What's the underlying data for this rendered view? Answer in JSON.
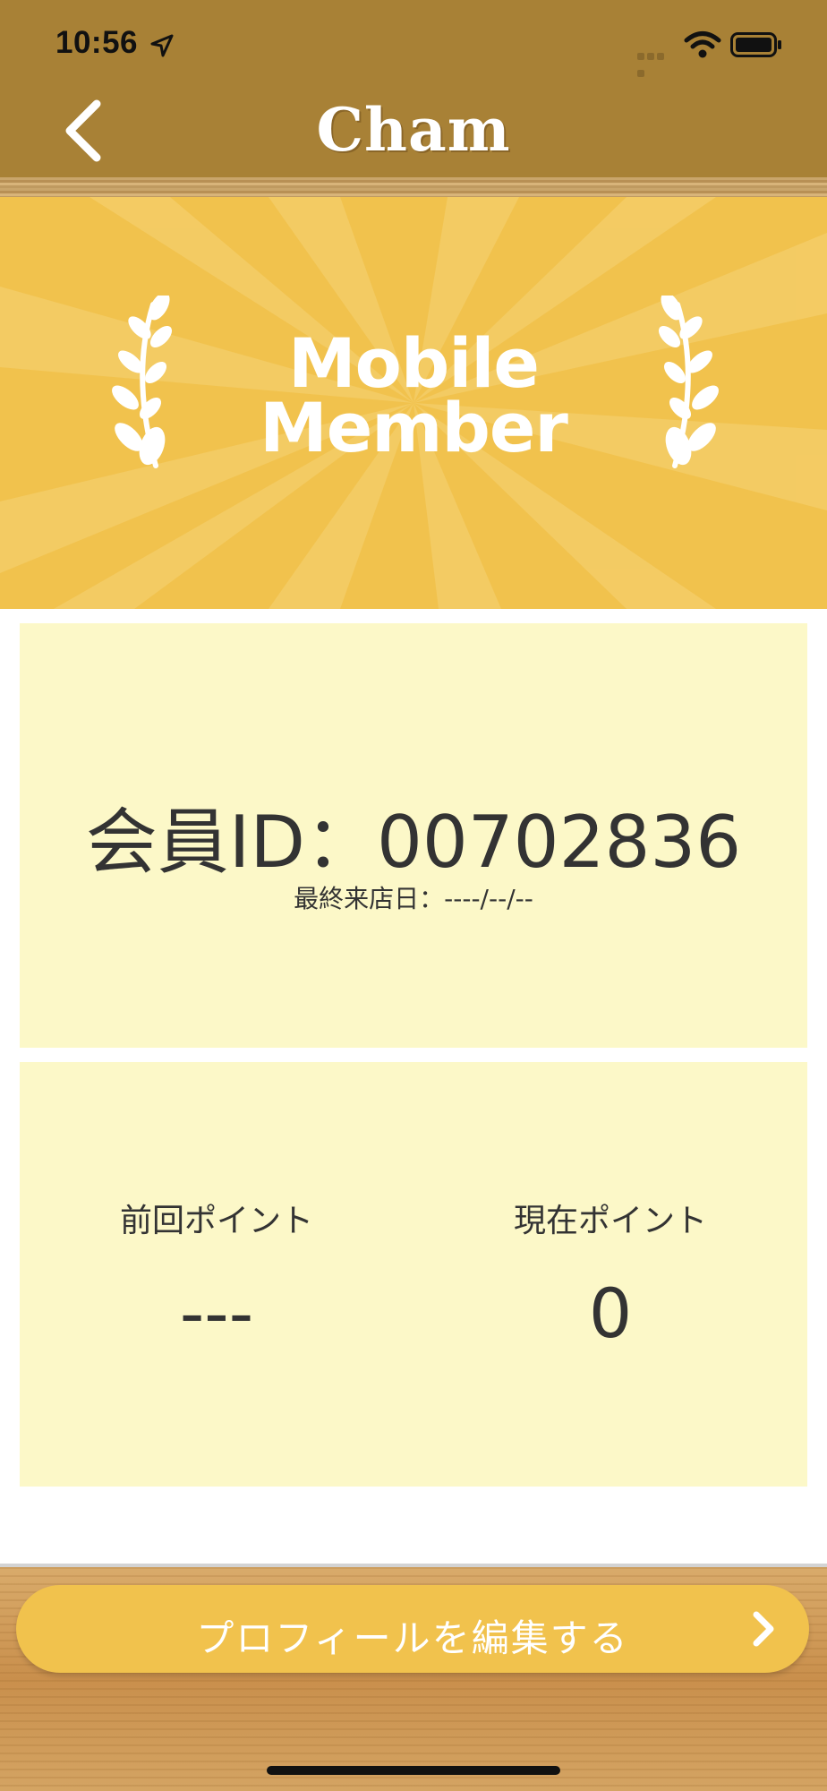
{
  "status_bar": {
    "time": "10:56"
  },
  "nav": {
    "brand": "Cham"
  },
  "hero": {
    "title_line1": "Mobile",
    "title_line2": "Member"
  },
  "member": {
    "id_text": "会員ID：00702836",
    "last_visit": "最終来店日：----/--/--"
  },
  "points": {
    "previous_label": "前回ポイント",
    "previous_value": "---",
    "current_label": "現在ポイント",
    "current_value": "0"
  },
  "actions": {
    "edit_profile_label": "プロフィールを編集する"
  },
  "colors": {
    "nav_bg": "#a88136",
    "accent_yellow": "#f1c24d",
    "card_bg": "#fcf8c8",
    "text": "#333333"
  },
  "icons": [
    "location-arrow-icon",
    "signal-icon",
    "wifi-icon",
    "battery-icon",
    "back-chevron-icon",
    "laurel-icon",
    "chevron-right-icon"
  ]
}
